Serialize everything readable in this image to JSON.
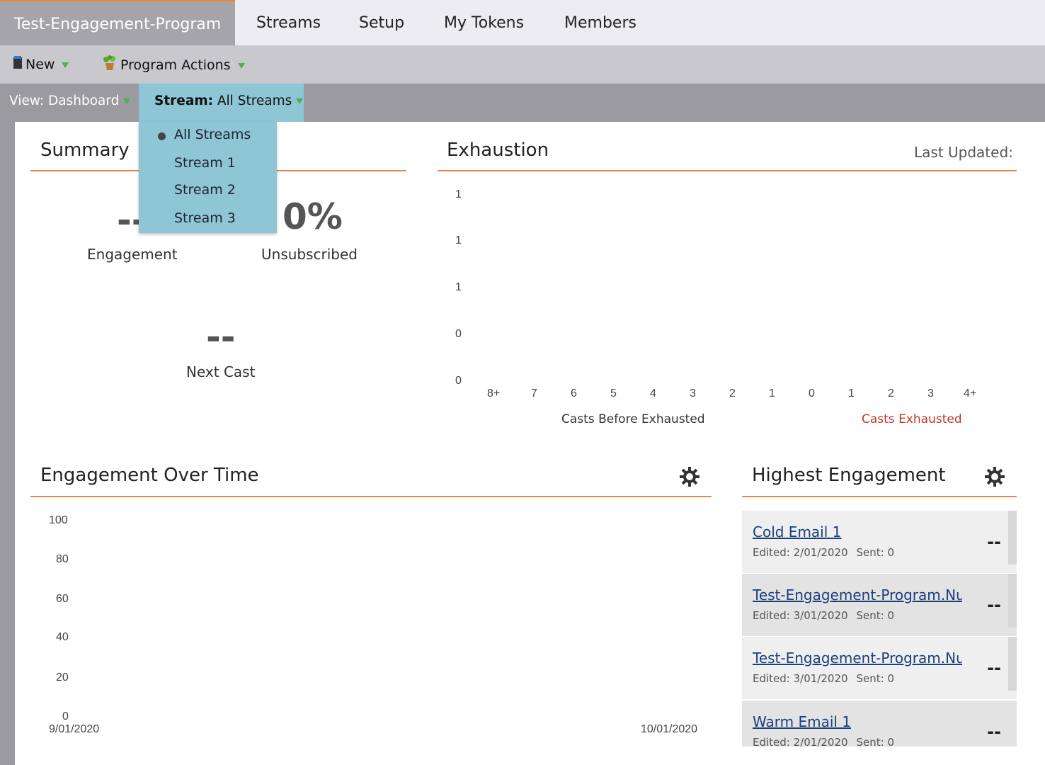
{
  "tabs": [
    {
      "label": "Test-Engagement-Program",
      "active": true
    },
    {
      "label": "Streams"
    },
    {
      "label": "Setup"
    },
    {
      "label": "My Tokens"
    },
    {
      "label": "Members"
    }
  ],
  "toolbar": {
    "new_label": "New",
    "program_actions_label": "Program Actions",
    "new_icon": "document-icon",
    "program_actions_icon": "plant-icon"
  },
  "viewbar": {
    "view_label": "View: Dashboard",
    "stream_prefix": "Stream:",
    "stream_value": "All Streams"
  },
  "stream_menu": {
    "items": [
      "All Streams",
      "Stream 1",
      "Stream 2",
      "Stream 3"
    ],
    "selected": "All Streams"
  },
  "summary": {
    "title": "Summary",
    "engagement_value": "--",
    "engagement_label": "Engagement",
    "unsubscribed_value": "0%",
    "unsubscribed_label": "Unsubscribed",
    "next_cast_value": "--",
    "next_cast_label": "Next Cast"
  },
  "exhaustion": {
    "title": "Exhaustion",
    "last_updated": "Last Updated:",
    "y_ticks": [
      "1",
      "1",
      "1",
      "0",
      "0"
    ],
    "x_ticks": [
      "8+",
      "7",
      "6",
      "5",
      "4",
      "3",
      "2",
      "1",
      "0",
      "1",
      "2",
      "3",
      "4+"
    ],
    "label_before": "Casts Before Exhausted",
    "label_exhausted": "Casts Exhausted"
  },
  "engagement_over_time": {
    "title": "Engagement Over Time",
    "y_ticks": [
      "100",
      "80",
      "60",
      "40",
      "20",
      "0"
    ],
    "x_start": "9/01/2020",
    "x_end": "10/01/2020"
  },
  "highest_engagement": {
    "title": "Highest Engagement",
    "edited_prefix": "Edited:",
    "sent_prefix": "Sent:",
    "rows": [
      {
        "name": "Cold Email 1",
        "edited": "Edited: 2/01/2020",
        "sent": "Sent: 0",
        "score": "--"
      },
      {
        "name": "Test-Engagement-Program.Nurture",
        "edited": "Edited: 3/01/2020",
        "sent": "Sent: 0",
        "score": "--"
      },
      {
        "name": "Test-Engagement-Program.Nurture",
        "edited": "Edited: 3/01/2020",
        "sent": "Sent: 0",
        "score": "--"
      },
      {
        "name": "Warm Email 1",
        "edited": "Edited: 2/01/2020",
        "sent": "Sent: 0",
        "score": "--"
      }
    ]
  },
  "colors": {
    "accent_rule": "#e0874a",
    "dropdown_bg": "#8fc6d6",
    "exhausted_label": "#c0392b",
    "link": "#1a3f7a"
  }
}
